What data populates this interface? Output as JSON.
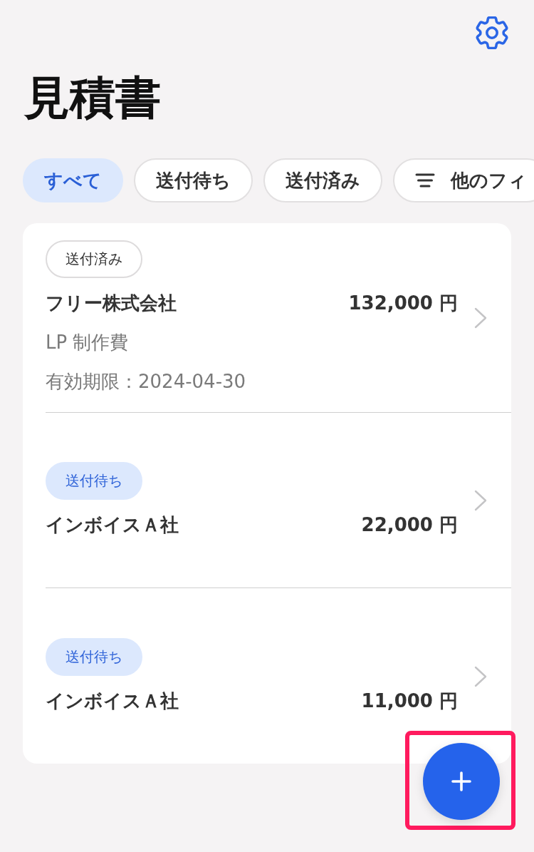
{
  "header": {
    "title": "見積書"
  },
  "filters": [
    {
      "label": "すべて",
      "selected": true,
      "kind": "status"
    },
    {
      "label": "送付待ち",
      "selected": false,
      "kind": "status"
    },
    {
      "label": "送付済み",
      "selected": false,
      "kind": "status"
    },
    {
      "label": "他のフィ",
      "selected": false,
      "kind": "more"
    }
  ],
  "quotes": [
    {
      "status": {
        "label": "送付済み",
        "kind": "sent"
      },
      "client": "フリー株式会社",
      "amount": "132,000 円",
      "subject": "LP 制作費",
      "expiry": "有効期限：2024-04-30"
    },
    {
      "status": {
        "label": "送付待ち",
        "kind": "pending"
      },
      "client": "インボイスＡ社",
      "amount": "22,000 円"
    },
    {
      "status": {
        "label": "送付待ち",
        "kind": "pending"
      },
      "client": "インボイスＡ社",
      "amount": "11,000 円"
    }
  ],
  "fab": {
    "highlighted": true
  }
}
